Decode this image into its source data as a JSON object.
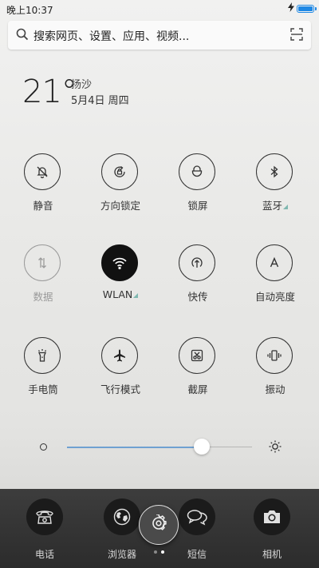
{
  "status_bar": {
    "time": "晚上10:37",
    "battery_color": "#1e88e5"
  },
  "search": {
    "placeholder": "搜索网页、设置、应用、视频..."
  },
  "weather": {
    "temperature": "21°",
    "city": "扬沙",
    "date": "5月4日 周四"
  },
  "toggles": [
    {
      "label": "静音",
      "icon": "bell-mute-icon",
      "state": "off"
    },
    {
      "label": "方向锁定",
      "icon": "rotation-lock-icon",
      "state": "off"
    },
    {
      "label": "锁屏",
      "icon": "lock-icon",
      "state": "off"
    },
    {
      "label": "蓝牙",
      "icon": "bluetooth-icon",
      "state": "off",
      "has_more": true
    },
    {
      "label": "数据",
      "icon": "mobile-data-icon",
      "state": "disabled"
    },
    {
      "label": "WLAN",
      "icon": "wifi-icon",
      "state": "on",
      "has_more": true
    },
    {
      "label": "快传",
      "icon": "quick-transfer-icon",
      "state": "off"
    },
    {
      "label": "自动亮度",
      "icon": "auto-brightness-icon",
      "state": "off"
    },
    {
      "label": "手电筒",
      "icon": "flashlight-icon",
      "state": "off"
    },
    {
      "label": "飞行模式",
      "icon": "airplane-icon",
      "state": "off"
    },
    {
      "label": "截屏",
      "icon": "screenshot-icon",
      "state": "off"
    },
    {
      "label": "振动",
      "icon": "vibrate-icon",
      "state": "off"
    }
  ],
  "brightness": {
    "level": 0.73,
    "accent": "#6fa1d1"
  },
  "dock": {
    "apps": [
      {
        "label": "电话",
        "icon": "phone-icon"
      },
      {
        "label": "浏览器",
        "icon": "browser-icon"
      },
      {
        "label": "短信",
        "icon": "message-icon"
      },
      {
        "label": "相机",
        "icon": "camera-icon"
      }
    ],
    "settings_icon": "settings-icon",
    "page_count": 2,
    "current_page": 2
  }
}
